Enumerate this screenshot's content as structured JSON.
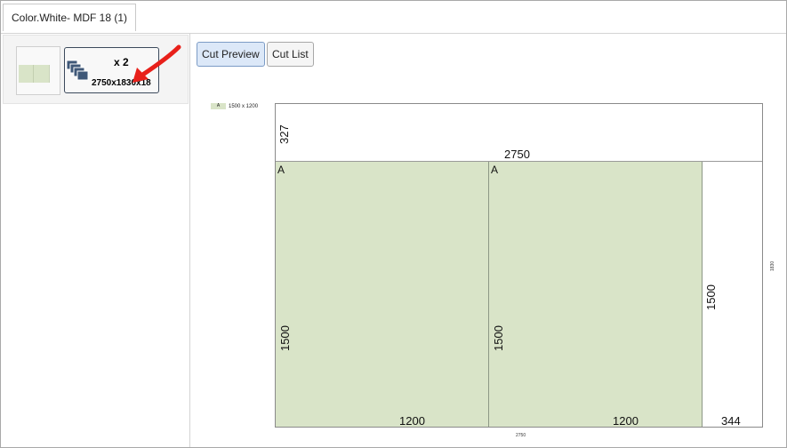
{
  "tab": {
    "title": "Color.White- MDF 18 (1)"
  },
  "thumbnails": [
    {
      "kind": "mini-layout"
    },
    {
      "count": "x 2",
      "dims": "2750x1830x18",
      "icon": "sheets-stack-icon"
    }
  ],
  "toolbar": {
    "cut_preview": "Cut Preview",
    "cut_list": "Cut List"
  },
  "legend": {
    "swatch": "A",
    "text": "1500 x 1200"
  },
  "sheet": {
    "top_strip_height": "327",
    "top_strip_width": "2750",
    "parts": [
      {
        "label": "A",
        "height": "1500",
        "width": "1200"
      },
      {
        "label": "A",
        "height": "1500",
        "width": "1200"
      }
    ],
    "remainder_height": "1500",
    "remainder_width": "344",
    "side_label": "1830",
    "bottom_label": "2750"
  },
  "colors": {
    "part_fill": "#d9e4c8",
    "active_button": "#dce8f8",
    "arrow": "#e8201a"
  }
}
